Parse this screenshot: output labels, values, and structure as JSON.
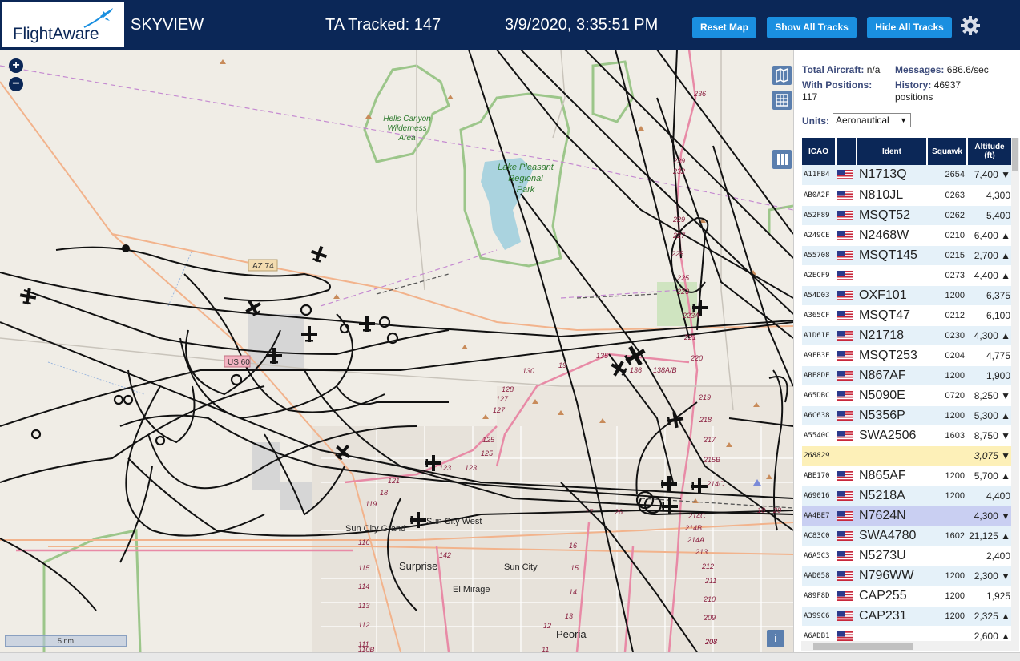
{
  "header": {
    "logo_text": "FlightAware",
    "app_title": "SKYVIEW",
    "tracked": "TA Tracked: 147",
    "datetime": "3/9/2020, 3:35:51 PM",
    "buttons": {
      "reset": "Reset Map",
      "show": "Show All Tracks",
      "hide": "Hide All Tracks"
    }
  },
  "map": {
    "zoom_in": "+",
    "zoom_out": "−",
    "scale": "5 nm",
    "info": "i",
    "labels": {
      "hells": "Hells Canyon",
      "wilderness": "Wilderness",
      "area": "Area",
      "lake": "Lake Pleasant",
      "regional": "Regional",
      "park": "Park",
      "az74": "AZ 74",
      "us60": "US 60",
      "sun_city_grand": "Sun City Grand",
      "sun_city_west": "Sun City West",
      "surprise": "Surprise",
      "sun_city": "Sun City",
      "el_mirage": "El Mirage",
      "peoria": "Peoria"
    },
    "road_numbers": [
      "236",
      "232",
      "229",
      "229",
      "227",
      "225",
      "225",
      "223",
      "223A",
      "221",
      "220",
      "219",
      "218",
      "217",
      "215B",
      "214C",
      "214C",
      "214B",
      "214A",
      "213",
      "212",
      "211",
      "210",
      "209",
      "208",
      "207",
      "135",
      "136",
      "138A/B",
      "130",
      "128",
      "127",
      "127",
      "125",
      "125",
      "123",
      "123",
      "121",
      "119",
      "116",
      "115",
      "114",
      "113",
      "112",
      "111",
      "110B",
      "142",
      "17",
      "16",
      "15",
      "14",
      "13",
      "12",
      "11",
      "10",
      "20",
      "26",
      "18",
      "19",
      "13"
    ]
  },
  "sidebar": {
    "total_label": "Total Aircraft:",
    "total_value": "n/a",
    "messages_label": "Messages:",
    "messages_value": "686.6/sec",
    "positions_label": "With Positions:",
    "positions_value": "117",
    "history_label": "History:",
    "history_value": "46937",
    "history_unit": "positions",
    "units_label": "Units:",
    "units_value": "Aeronautical",
    "columns": {
      "icao": "ICAO",
      "ident": "Ident",
      "squawk": "Squawk",
      "alt1": "Altitude",
      "alt2": "(ft)"
    },
    "aircraft": [
      {
        "icao": "A11FB4",
        "ident": "N1713Q",
        "squawk": "2654",
        "alt": "7,400 ▼"
      },
      {
        "icao": "AB0A2F",
        "ident": "N810JL",
        "squawk": "0263",
        "alt": "4,300"
      },
      {
        "icao": "A52F89",
        "ident": "MSQT52",
        "squawk": "0262",
        "alt": "5,400"
      },
      {
        "icao": "A249CE",
        "ident": "N2468W",
        "squawk": "0210",
        "alt": "6,400 ▲"
      },
      {
        "icao": "A55708",
        "ident": "MSQT145",
        "squawk": "0215",
        "alt": "2,700 ▲"
      },
      {
        "icao": "A2ECF9",
        "ident": "",
        "squawk": "0273",
        "alt": "4,400 ▲"
      },
      {
        "icao": "A54D03",
        "ident": "OXF101",
        "squawk": "1200",
        "alt": "6,375"
      },
      {
        "icao": "A365CF",
        "ident": "MSQT47",
        "squawk": "0212",
        "alt": "6,100"
      },
      {
        "icao": "A1D61F",
        "ident": "N21718",
        "squawk": "0230",
        "alt": "4,300 ▲"
      },
      {
        "icao": "A9FB3E",
        "ident": "MSQT253",
        "squawk": "0204",
        "alt": "4,775"
      },
      {
        "icao": "ABE8DE",
        "ident": "N867AF",
        "squawk": "1200",
        "alt": "1,900"
      },
      {
        "icao": "A65DBC",
        "ident": "N5090E",
        "squawk": "0720",
        "alt": "8,250 ▼"
      },
      {
        "icao": "A6C638",
        "ident": "N5356P",
        "squawk": "1200",
        "alt": "5,300 ▲"
      },
      {
        "icao": "A5540C",
        "ident": "SWA2506",
        "squawk": "1603",
        "alt": "8,750 ▼"
      },
      {
        "icao": "268829",
        "ident": "",
        "squawk": "",
        "alt": "3,075 ▼"
      },
      {
        "icao": "ABE170",
        "ident": "N865AF",
        "squawk": "1200",
        "alt": "5,700 ▲"
      },
      {
        "icao": "A69016",
        "ident": "N5218A",
        "squawk": "1200",
        "alt": "4,400"
      },
      {
        "icao": "AA4BE7",
        "ident": "N7624N",
        "squawk": "",
        "alt": "4,300 ▼"
      },
      {
        "icao": "AC83C0",
        "ident": "SWA4780",
        "squawk": "1602",
        "alt": "21,125 ▲"
      },
      {
        "icao": "A6A5C3",
        "ident": "N5273U",
        "squawk": "",
        "alt": "2,400"
      },
      {
        "icao": "AAD058",
        "ident": "N796WW",
        "squawk": "1200",
        "alt": "2,300 ▼"
      },
      {
        "icao": "A89F8D",
        "ident": "CAP255",
        "squawk": "1200",
        "alt": "1,925"
      },
      {
        "icao": "A399C6",
        "ident": "CAP231",
        "squawk": "1200",
        "alt": "2,325 ▲"
      },
      {
        "icao": "A6ADB1",
        "ident": "",
        "squawk": "",
        "alt": "2,600 ▲"
      }
    ]
  },
  "colors": {
    "header": "#0b2757",
    "button": "#1a8fe0",
    "row_alt": "#e5f1f9",
    "row_highlight": "#fdf0b8",
    "row_selected": "#c9cff2"
  }
}
